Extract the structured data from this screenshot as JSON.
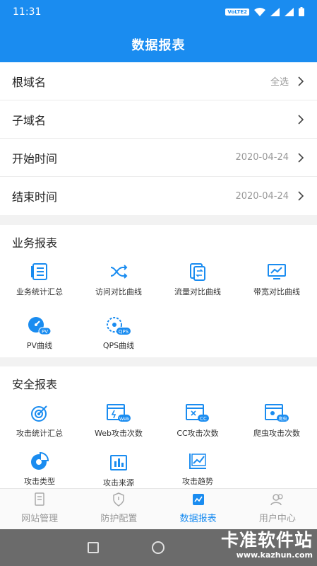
{
  "status_bar": {
    "time": "11:31",
    "volte": "VoLTE2"
  },
  "header": {
    "title": "数据报表"
  },
  "filters": [
    {
      "label": "根域名",
      "value": "全选"
    },
    {
      "label": "子域名",
      "value": ""
    },
    {
      "label": "开始时间",
      "value": "2020-04-24"
    },
    {
      "label": "结束时间",
      "value": "2020-04-24"
    }
  ],
  "business_reports": {
    "title": "业务报表",
    "items": [
      {
        "label": "业务统计汇总",
        "icon": "stats-list-icon"
      },
      {
        "label": "访问对比曲线",
        "icon": "shuffle-icon"
      },
      {
        "label": "流量对比曲线",
        "icon": "traffic-icon"
      },
      {
        "label": "带宽对比曲线",
        "icon": "monitor-chart-icon"
      },
      {
        "label": "PV曲线",
        "icon": "pv-gauge-icon",
        "badge": "PV"
      },
      {
        "label": "QPS曲线",
        "icon": "qps-gauge-icon",
        "badge": "QPS"
      }
    ]
  },
  "security_reports": {
    "title": "安全报表",
    "items": [
      {
        "label": "攻击统计汇总",
        "icon": "target-icon"
      },
      {
        "label": "Web攻击次数",
        "icon": "web-attack-icon",
        "badge": "Web"
      },
      {
        "label": "CC攻击次数",
        "icon": "cc-attack-icon",
        "badge": "CC"
      },
      {
        "label": "爬虫攻击次数",
        "icon": "crawler-attack-icon",
        "badge": "爬虫"
      },
      {
        "label": "攻击类型",
        "icon": "pie-chart-icon"
      },
      {
        "label": "攻击来源",
        "icon": "bar-chart-icon"
      },
      {
        "label": "攻击趋势",
        "icon": "trend-icon"
      }
    ]
  },
  "tabs": [
    {
      "label": "网站管理",
      "icon": "document-icon",
      "active": false
    },
    {
      "label": "防护配置",
      "icon": "shield-icon",
      "active": false
    },
    {
      "label": "数据报表",
      "icon": "chart-icon",
      "active": true
    },
    {
      "label": "用户中心",
      "icon": "users-icon",
      "active": false
    }
  ],
  "watermark": {
    "name": "卡准软件站",
    "url": "www.kazhun.com"
  },
  "colors": {
    "primary": "#1a8cf0",
    "background": "#f2f2f2"
  }
}
